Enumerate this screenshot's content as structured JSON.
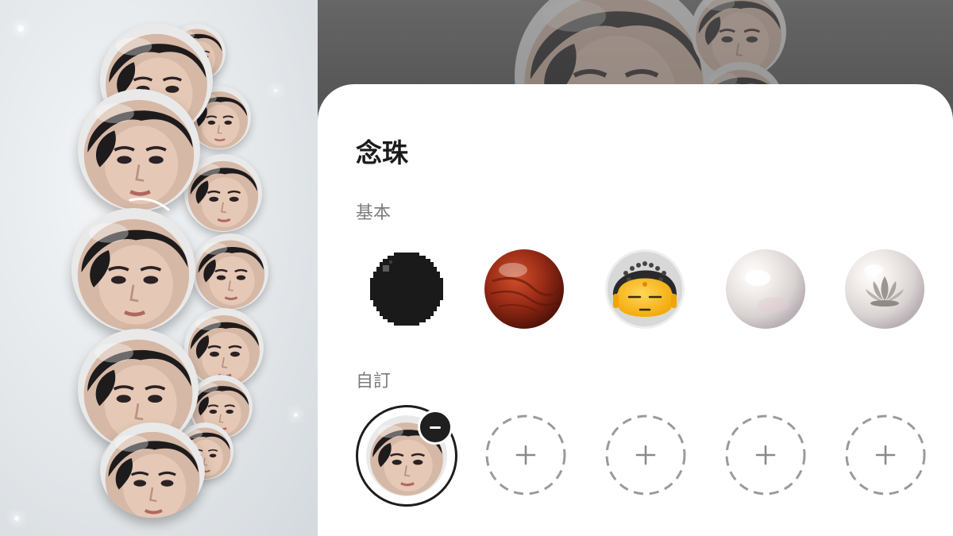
{
  "sheet": {
    "title": "念珠",
    "sections": {
      "basic": {
        "label": "基本"
      },
      "custom": {
        "label": "自訂"
      }
    }
  },
  "bead_options": [
    {
      "name": "black-pixel",
      "icon": "black-pixel-bead-icon"
    },
    {
      "name": "rosewood",
      "icon": "rosewood-bead-icon"
    },
    {
      "name": "buddha-emoji",
      "icon": "buddha-emoji-bead-icon"
    },
    {
      "name": "pearl",
      "icon": "pearl-bead-icon"
    },
    {
      "name": "lotus-pearl",
      "icon": "lotus-pearl-bead-icon"
    }
  ],
  "custom_slots": [
    {
      "state": "filled",
      "icon": "photo-face-bead-icon",
      "badge_icon": "minus-icon"
    },
    {
      "state": "empty",
      "icon": "plus-icon"
    },
    {
      "state": "empty",
      "icon": "plus-icon"
    },
    {
      "state": "empty",
      "icon": "plus-icon"
    },
    {
      "state": "empty",
      "icon": "plus-icon"
    }
  ],
  "colors": {
    "sheet_background": "#ffffff",
    "title_text": "#1b1b1b",
    "section_label_text": "#7b7b7b",
    "overlay_dim": "#5a5a5a",
    "dashed_border": "#9a9a9a"
  }
}
